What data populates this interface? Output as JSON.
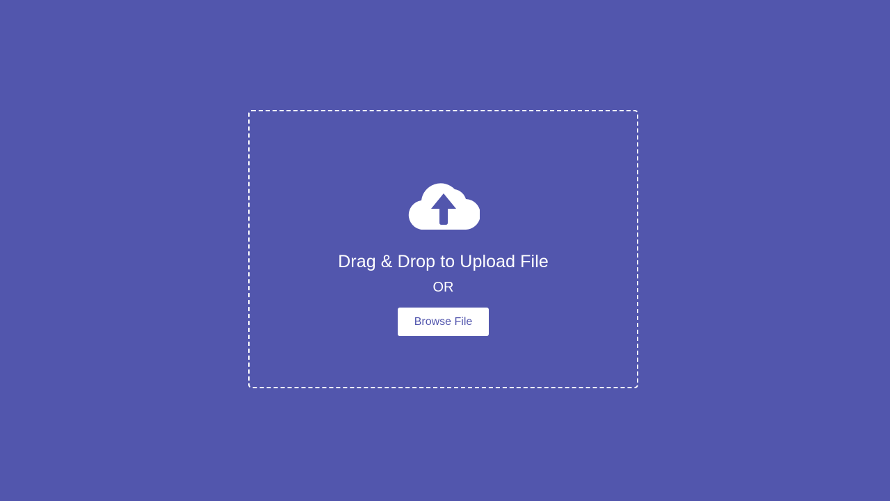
{
  "upload": {
    "icon": "cloud-upload-icon",
    "title": "Drag & Drop to Upload File",
    "separator": "OR",
    "browse_label": "Browse File"
  },
  "colors": {
    "background": "#5256ad",
    "foreground": "#ffffff",
    "button_text": "#5256ad"
  }
}
